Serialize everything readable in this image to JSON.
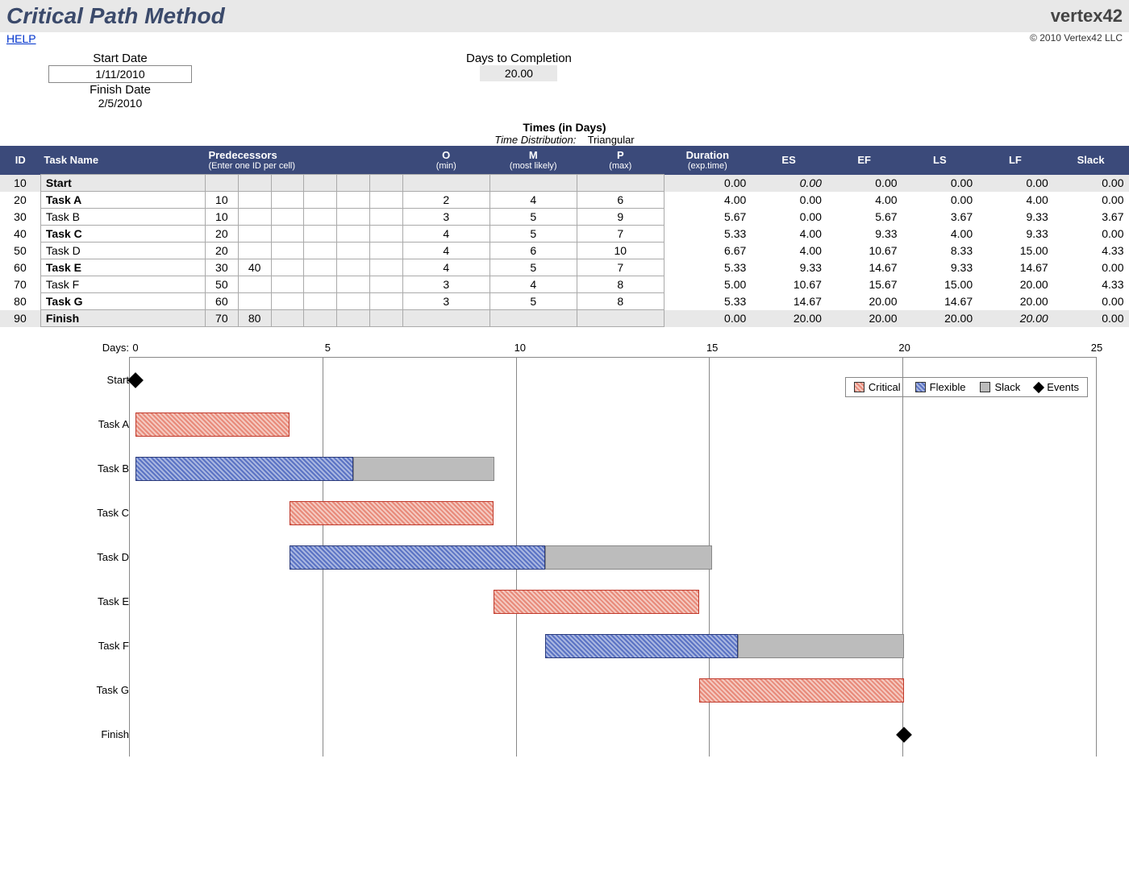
{
  "header": {
    "title": "Critical Path Method",
    "logo": "vertex42",
    "copyright": "© 2010 Vertex42 LLC",
    "help": "HELP"
  },
  "meta": {
    "start_date_label": "Start Date",
    "start_date": "1/11/2010",
    "finish_date_label": "Finish Date",
    "finish_date": "2/5/2010",
    "days_to_completion_label": "Days to Completion",
    "days_to_completion": "20.00"
  },
  "times_header": "Times (in Days)",
  "time_distribution_label": "Time Distribution:",
  "time_distribution_value": "Triangular",
  "columns": {
    "id": "ID",
    "task": "Task Name",
    "pred": "Predecessors",
    "pred_sub": "(Enter one ID per cell)",
    "o": "O",
    "o_sub": "(min)",
    "m": "M",
    "m_sub": "(most likely)",
    "p": "P",
    "p_sub": "(max)",
    "dur": "Duration",
    "dur_sub": "(exp.time)",
    "es": "ES",
    "ef": "EF",
    "ls": "LS",
    "lf": "LF",
    "slack": "Slack"
  },
  "rows": [
    {
      "id": "10",
      "task": "Start",
      "bold": true,
      "shaded": true,
      "pred": [
        "",
        "",
        "",
        "",
        "",
        ""
      ],
      "o": "",
      "m": "",
      "p": "",
      "dur": "0.00",
      "es": "0.00",
      "es_italic": true,
      "ef": "0.00",
      "ls": "0.00",
      "lf": "0.00",
      "slack": "0.00"
    },
    {
      "id": "20",
      "task": "Task A",
      "bold": true,
      "pred": [
        "10",
        "",
        "",
        "",
        "",
        ""
      ],
      "o": "2",
      "m": "4",
      "p": "6",
      "dur": "4.00",
      "es": "0.00",
      "ef": "4.00",
      "ls": "0.00",
      "lf": "4.00",
      "slack": "0.00"
    },
    {
      "id": "30",
      "task": "Task B",
      "pred": [
        "10",
        "",
        "",
        "",
        "",
        ""
      ],
      "o": "3",
      "m": "5",
      "p": "9",
      "dur": "5.67",
      "es": "0.00",
      "ef": "5.67",
      "ls": "3.67",
      "lf": "9.33",
      "slack": "3.67"
    },
    {
      "id": "40",
      "task": "Task C",
      "bold": true,
      "pred": [
        "20",
        "",
        "",
        "",
        "",
        ""
      ],
      "o": "4",
      "m": "5",
      "p": "7",
      "dur": "5.33",
      "es": "4.00",
      "ef": "9.33",
      "ls": "4.00",
      "lf": "9.33",
      "slack": "0.00"
    },
    {
      "id": "50",
      "task": "Task D",
      "pred": [
        "20",
        "",
        "",
        "",
        "",
        ""
      ],
      "o": "4",
      "m": "6",
      "p": "10",
      "dur": "6.67",
      "es": "4.00",
      "ef": "10.67",
      "ls": "8.33",
      "lf": "15.00",
      "slack": "4.33"
    },
    {
      "id": "60",
      "task": "Task E",
      "bold": true,
      "pred": [
        "30",
        "40",
        "",
        "",
        "",
        ""
      ],
      "o": "4",
      "m": "5",
      "p": "7",
      "dur": "5.33",
      "es": "9.33",
      "ef": "14.67",
      "ls": "9.33",
      "lf": "14.67",
      "slack": "0.00"
    },
    {
      "id": "70",
      "task": "Task F",
      "pred": [
        "50",
        "",
        "",
        "",
        "",
        ""
      ],
      "o": "3",
      "m": "4",
      "p": "8",
      "dur": "5.00",
      "es": "10.67",
      "ef": "15.67",
      "ls": "15.00",
      "lf": "20.00",
      "slack": "4.33"
    },
    {
      "id": "80",
      "task": "Task G",
      "bold": true,
      "pred": [
        "60",
        "",
        "",
        "",
        "",
        ""
      ],
      "o": "3",
      "m": "5",
      "p": "8",
      "dur": "5.33",
      "es": "14.67",
      "ef": "20.00",
      "ls": "14.67",
      "lf": "20.00",
      "slack": "0.00"
    },
    {
      "id": "90",
      "task": "Finish",
      "bold": true,
      "shaded": true,
      "pred": [
        "70",
        "80",
        "",
        "",
        "",
        ""
      ],
      "o": "",
      "m": "",
      "p": "",
      "dur": "0.00",
      "es": "20.00",
      "ef": "20.00",
      "ls": "20.00",
      "lf": "20.00",
      "lf_italic": true,
      "slack": "0.00"
    }
  ],
  "chart_data": {
    "type": "bar",
    "xlabel": "Days:",
    "xlim": [
      0,
      25
    ],
    "ticks": [
      0,
      5,
      10,
      15,
      20,
      25
    ],
    "legend": [
      "Critical",
      "Flexible",
      "Slack",
      "Events"
    ],
    "series": [
      {
        "name": "Start",
        "type": "event",
        "x": 0
      },
      {
        "name": "Task A",
        "type": "critical",
        "start": 0,
        "end": 4,
        "slack": 0
      },
      {
        "name": "Task B",
        "type": "flexible",
        "start": 0,
        "end": 5.67,
        "slack": 3.67
      },
      {
        "name": "Task C",
        "type": "critical",
        "start": 4,
        "end": 9.33,
        "slack": 0
      },
      {
        "name": "Task D",
        "type": "flexible",
        "start": 4,
        "end": 10.67,
        "slack": 4.33
      },
      {
        "name": "Task E",
        "type": "critical",
        "start": 9.33,
        "end": 14.67,
        "slack": 0
      },
      {
        "name": "Task F",
        "type": "flexible",
        "start": 10.67,
        "end": 15.67,
        "slack": 4.33
      },
      {
        "name": "Task G",
        "type": "critical",
        "start": 14.67,
        "end": 20,
        "slack": 0
      },
      {
        "name": "Finish",
        "type": "event",
        "x": 20
      }
    ]
  }
}
